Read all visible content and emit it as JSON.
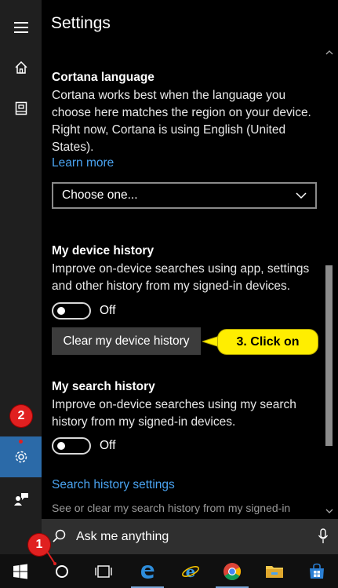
{
  "settings": {
    "title": "Settings",
    "cortana_language": {
      "heading": "Cortana language",
      "description": "Cortana works best when the language you choose here matches the region on your device. Right now, Cortana is using English (United States).",
      "learn_more": "Learn more",
      "dropdown_value": "Choose one..."
    },
    "device_history": {
      "heading": "My device history",
      "description": "Improve on-device searches using app, settings and other history from my signed-in devices.",
      "toggle_label": "Off",
      "clear_button": "Clear my device history"
    },
    "search_history": {
      "heading": "My search history",
      "description": "Improve on-device searches using my search history from my signed-in devices.",
      "toggle_label": "Off",
      "settings_link": "Search history settings",
      "footer_text": "See or clear my search history from my signed-in"
    }
  },
  "annotations": {
    "callout": "3. Click on",
    "badge_1": "1",
    "badge_2": "2"
  },
  "search": {
    "placeholder": "Ask me anything"
  },
  "icons": {
    "rail": [
      "hamburger-icon",
      "home-icon",
      "notebook-icon",
      "gear-icon",
      "feedback-icon"
    ],
    "taskbar": [
      "windows-logo-icon",
      "cortana-circle-icon",
      "task-view-icon",
      "edge-icon",
      "internet-explorer-icon",
      "chrome-icon",
      "file-explorer-icon",
      "store-icon"
    ]
  },
  "colors": {
    "accent": "#2b6aa8",
    "link": "#4aa3f0",
    "callout": "#ffee00",
    "badge": "#e02020"
  }
}
